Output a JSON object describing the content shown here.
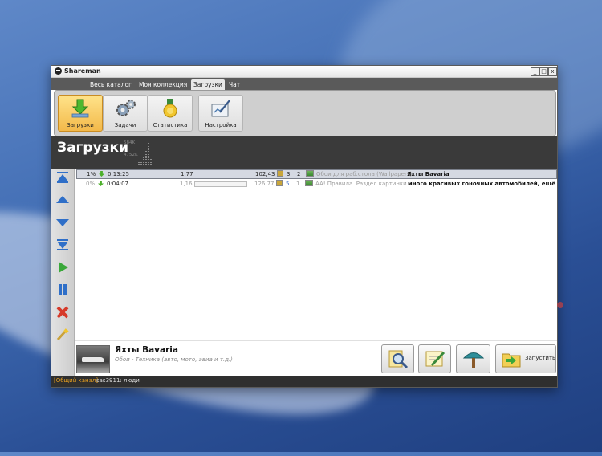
{
  "window": {
    "title": "Shareman",
    "minimize": "_",
    "maximize": "□",
    "close": "x"
  },
  "tabs": [
    {
      "label": "Весь каталог"
    },
    {
      "label": "Моя коллекция"
    },
    {
      "label": "Загрузки",
      "active": true
    },
    {
      "label": "Чат"
    }
  ],
  "toolbar": {
    "downloads": "Загрузки",
    "tasks": "Задачи",
    "statistics": "Статистика",
    "settings": "Настройка"
  },
  "header": {
    "title": "Загрузки",
    "speed_top": "584K",
    "speed_bottom": "4752K"
  },
  "sidebar_icons": [
    "move-top-icon",
    "move-up-icon",
    "move-down-icon",
    "move-bottom-icon",
    "play-icon",
    "pause-icon",
    "delete-icon",
    "clean-icon"
  ],
  "downloads": [
    {
      "percent": "1%",
      "time": "0:13:25",
      "speed": "1,77",
      "progress": 0.01,
      "size": "102,43",
      "peers": "3",
      "seeds": "2",
      "category": "Обои для раб.стола (Wallpapers)",
      "name": "Яхты Bavaria"
    },
    {
      "percent": "0%",
      "time": "0:04:07",
      "speed": "1,16",
      "progress": 0.0,
      "size": "126,77",
      "peers": "5",
      "seeds": "1",
      "category": "AA! Правила. Раздел картинки",
      "name": "много красивых гоночных автомобилей, ещё"
    }
  ],
  "details": {
    "title": "Яхты Bavaria",
    "subtitle": "Обои - Техника (авто, мото, авиа и т.д.)",
    "launch_label": "Запустить"
  },
  "status": {
    "channel": "[Общий канал]",
    "message": "sas3911: люди"
  },
  "colors": {
    "active_tab_bg": "#e8e8e8",
    "active_button": "#f3b94a",
    "header_bg": "#3a3a3a",
    "status_channel": "#e8a020"
  }
}
